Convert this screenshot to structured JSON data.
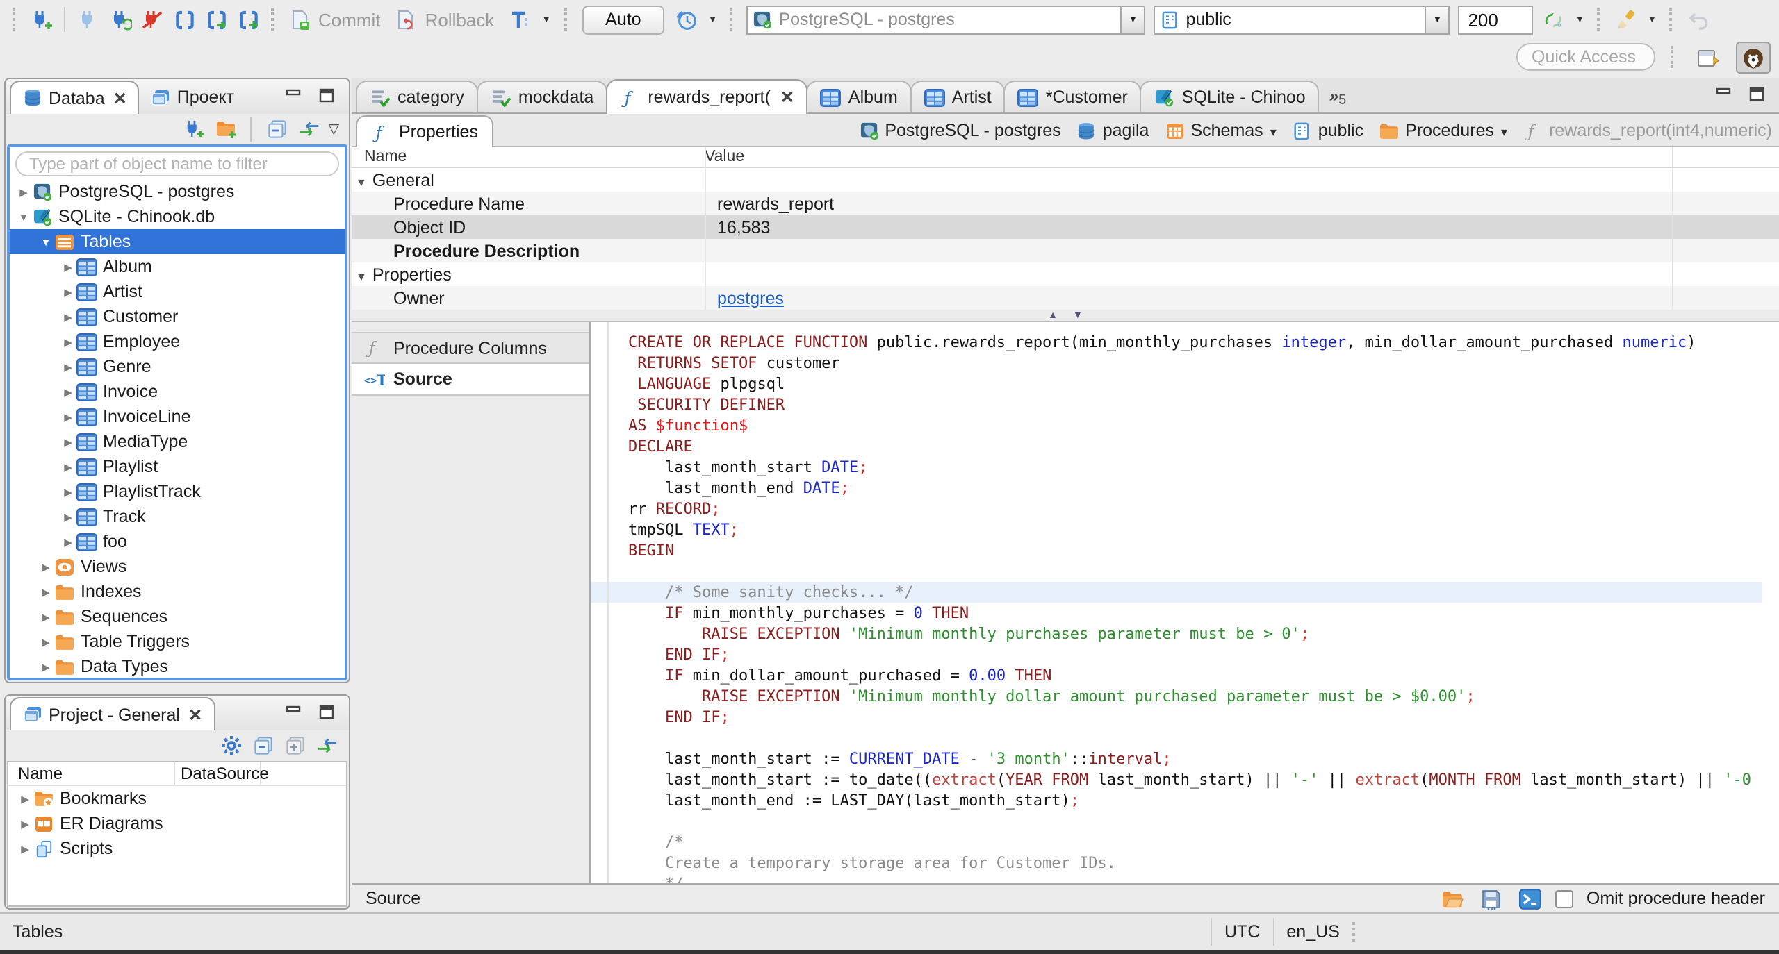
{
  "toolbar": {
    "commit": "Commit",
    "rollback": "Rollback",
    "auto": "Auto",
    "connection": "PostgreSQL - postgres",
    "schema": "public",
    "fetch_size": "200",
    "quick_access_placeholder": "Quick Access",
    "icons": [
      "new-connection",
      "connect",
      "invalidate-reconnect",
      "disconnect",
      "new-sql-editor",
      "open-sql-script",
      "new-sql-script",
      "commit-doc",
      "rollback-doc",
      "transaction-mode",
      "query-history",
      "refresh",
      "mock-data-wand",
      "undo",
      "open-perspective",
      "dbeaver-perspective"
    ],
    "accent_blue": "#3a7bd0",
    "accent_green": "#3fae3f",
    "accent_red": "#d8372a"
  },
  "navigator": {
    "tabs": [
      {
        "label": "Databa",
        "icon": "database",
        "active": true,
        "closable": true
      },
      {
        "label": "Проект",
        "icon": "projects"
      }
    ],
    "filter_placeholder": "Type part of object name to filter",
    "tree": [
      {
        "label": "PostgreSQL - postgres",
        "icon": "pg",
        "depth": 0,
        "exp": "right"
      },
      {
        "label": "SQLite - Chinook.db",
        "icon": "sqlite",
        "depth": 0,
        "exp": "down"
      },
      {
        "label": "Tables",
        "icon": "ftables",
        "depth": 1,
        "exp": "down",
        "selected": true
      },
      {
        "label": "Album",
        "icon": "table",
        "depth": 2,
        "exp": "right"
      },
      {
        "label": "Artist",
        "icon": "table",
        "depth": 2,
        "exp": "right"
      },
      {
        "label": "Customer",
        "icon": "table",
        "depth": 2,
        "exp": "right"
      },
      {
        "label": "Employee",
        "icon": "table",
        "depth": 2,
        "exp": "right"
      },
      {
        "label": "Genre",
        "icon": "table",
        "depth": 2,
        "exp": "right"
      },
      {
        "label": "Invoice",
        "icon": "table",
        "depth": 2,
        "exp": "right"
      },
      {
        "label": "InvoiceLine",
        "icon": "table",
        "depth": 2,
        "exp": "right"
      },
      {
        "label": "MediaType",
        "icon": "table",
        "depth": 2,
        "exp": "right"
      },
      {
        "label": "Playlist",
        "icon": "table",
        "depth": 2,
        "exp": "right"
      },
      {
        "label": "PlaylistTrack",
        "icon": "table",
        "depth": 2,
        "exp": "right"
      },
      {
        "label": "Track",
        "icon": "table",
        "depth": 2,
        "exp": "right"
      },
      {
        "label": "foo",
        "icon": "table",
        "depth": 2,
        "exp": "right"
      },
      {
        "label": "Views",
        "icon": "eye",
        "depth": 1,
        "exp": "right"
      },
      {
        "label": "Indexes",
        "icon": "folder",
        "depth": 1,
        "exp": "right"
      },
      {
        "label": "Sequences",
        "icon": "folder",
        "depth": 1,
        "exp": "right"
      },
      {
        "label": "Table Triggers",
        "icon": "folder",
        "depth": 1,
        "exp": "right"
      },
      {
        "label": "Data Types",
        "icon": "folder",
        "depth": 1,
        "exp": "right"
      }
    ]
  },
  "project_panel": {
    "title": "Project - General",
    "columns": [
      "Name",
      "DataSource"
    ],
    "items": [
      {
        "label": "Bookmarks",
        "icon": "fstar"
      },
      {
        "label": "ER Diagrams",
        "icon": "erd"
      },
      {
        "label": "Scripts",
        "icon": "scripts"
      }
    ]
  },
  "editor": {
    "tabs": [
      {
        "label": "category",
        "icon": "sqlfile"
      },
      {
        "label": "mockdata",
        "icon": "sqlfile"
      },
      {
        "label": "rewards_report(",
        "icon": "fx",
        "active": true,
        "closable": true
      },
      {
        "label": "Album",
        "icon": "table"
      },
      {
        "label": "Artist",
        "icon": "table"
      },
      {
        "label": "*Customer",
        "icon": "table"
      },
      {
        "label": "SQLite - Chinoo",
        "icon": "sqlite"
      }
    ],
    "overflow_count": "5",
    "properties_tab": "Properties",
    "breadcrumb": [
      {
        "label": "PostgreSQL - postgres",
        "icon": "pg"
      },
      {
        "label": "pagila",
        "icon": "db3"
      },
      {
        "label": "Schemas",
        "icon": "schemas",
        "dropdown": true
      },
      {
        "label": "public",
        "icon": "card"
      },
      {
        "label": "Procedures",
        "icon": "folder",
        "dropdown": true
      },
      {
        "label": "rewards_report(int4,numeric)",
        "icon": "fxg",
        "muted": true
      }
    ],
    "grid": {
      "columns": [
        "Name",
        "Value"
      ],
      "rows": [
        {
          "name": "General",
          "value": "",
          "group": true
        },
        {
          "name": "Procedure Name",
          "value": "rewards_report",
          "indent": 1
        },
        {
          "name": "Object ID",
          "value": "16,583",
          "indent": 1,
          "selected": true
        },
        {
          "name": "Procedure Description",
          "value": "",
          "indent": 1,
          "bold": true
        },
        {
          "name": "Properties",
          "value": "",
          "group": true
        },
        {
          "name": "Owner",
          "value": "postgres",
          "indent": 1,
          "link": true
        }
      ]
    },
    "subtabs": [
      {
        "label": "Procedure Columns",
        "icon": "fxg"
      },
      {
        "label": "Source",
        "icon": "source",
        "active": true
      }
    ],
    "status_left": "Source",
    "omit_checkbox_label": "Omit procedure header",
    "code": {
      "highlight_line": 13,
      "lines": [
        [
          [
            "k",
            "CREATE OR REPLACE FUNCTION "
          ],
          [
            "p",
            "public.rewards_report(min_monthly_purchases "
          ],
          [
            "t",
            "integer"
          ],
          [
            "p",
            ", min_dollar_amount_purchased "
          ],
          [
            "t",
            "numeric"
          ],
          [
            "p",
            ")"
          ]
        ],
        [
          [
            "k",
            " RETURNS SETOF "
          ],
          [
            "p",
            "customer"
          ]
        ],
        [
          [
            "k",
            " LANGUAGE "
          ],
          [
            "p",
            "plpgsql"
          ]
        ],
        [
          [
            "k",
            " SECURITY DEFINER"
          ]
        ],
        [
          [
            "k",
            "AS "
          ],
          [
            "d",
            "$function$"
          ]
        ],
        [
          [
            "k",
            "DECLARE"
          ]
        ],
        [
          [
            "p",
            "    last_month_start "
          ],
          [
            "t",
            "DATE"
          ],
          [
            "r",
            ";"
          ]
        ],
        [
          [
            "p",
            "    last_month_end "
          ],
          [
            "t",
            "DATE"
          ],
          [
            "r",
            ";"
          ]
        ],
        [
          [
            "p",
            "rr "
          ],
          [
            "k",
            "RECORD"
          ],
          [
            "r",
            ";"
          ]
        ],
        [
          [
            "p",
            "tmpSQL "
          ],
          [
            "t",
            "TEXT"
          ],
          [
            "r",
            ";"
          ]
        ],
        [
          [
            "k",
            "BEGIN"
          ]
        ],
        [],
        [
          [
            "c",
            "    /* Some sanity checks... */"
          ]
        ],
        [
          [
            "p",
            "    "
          ],
          [
            "k",
            "IF"
          ],
          [
            "p",
            " min_monthly_purchases = "
          ],
          [
            "n",
            "0"
          ],
          [
            "p",
            " "
          ],
          [
            "k",
            "THEN"
          ]
        ],
        [
          [
            "p",
            "        "
          ],
          [
            "k",
            "RAISE EXCEPTION "
          ],
          [
            "s",
            "'Minimum monthly purchases parameter must be > 0'"
          ],
          [
            "r",
            ";"
          ]
        ],
        [
          [
            "p",
            "    "
          ],
          [
            "k",
            "END IF"
          ],
          [
            "r",
            ";"
          ]
        ],
        [
          [
            "p",
            "    "
          ],
          [
            "k",
            "IF"
          ],
          [
            "p",
            " min_dollar_amount_purchased = "
          ],
          [
            "n",
            "0.00"
          ],
          [
            "p",
            " "
          ],
          [
            "k",
            "THEN"
          ]
        ],
        [
          [
            "p",
            "        "
          ],
          [
            "k",
            "RAISE EXCEPTION "
          ],
          [
            "s",
            "'Minimum monthly dollar amount purchased parameter must be > $0.00'"
          ],
          [
            "r",
            ";"
          ]
        ],
        [
          [
            "p",
            "    "
          ],
          [
            "k",
            "END IF"
          ],
          [
            "r",
            ";"
          ]
        ],
        [],
        [
          [
            "p",
            "    last_month_start := "
          ],
          [
            "t",
            "CURRENT_DATE"
          ],
          [
            "p",
            " - "
          ],
          [
            "s",
            "'3 month'"
          ],
          [
            "p",
            "::"
          ],
          [
            "k",
            "interval"
          ],
          [
            "r",
            ";"
          ]
        ],
        [
          [
            "p",
            "    last_month_start := to_date(("
          ],
          [
            "f",
            "extract"
          ],
          [
            "p",
            "("
          ],
          [
            "k",
            "YEAR FROM"
          ],
          [
            "p",
            " last_month_start) || "
          ],
          [
            "s",
            "'-'"
          ],
          [
            "p",
            " || "
          ],
          [
            "f",
            "extract"
          ],
          [
            "p",
            "("
          ],
          [
            "k",
            "MONTH FROM"
          ],
          [
            "p",
            " last_month_start) || "
          ],
          [
            "s",
            "'-0"
          ]
        ],
        [
          [
            "p",
            "    last_month_end := LAST_DAY(last_month_start)"
          ],
          [
            "r",
            ";"
          ]
        ],
        [],
        [
          [
            "c",
            "    /*"
          ]
        ],
        [
          [
            "c",
            "    Create a temporary storage area for Customer IDs."
          ]
        ],
        [
          [
            "c",
            "    */"
          ]
        ]
      ]
    }
  },
  "statusbar": {
    "left": "Tables",
    "timezone": "UTC",
    "locale": "en_US"
  }
}
